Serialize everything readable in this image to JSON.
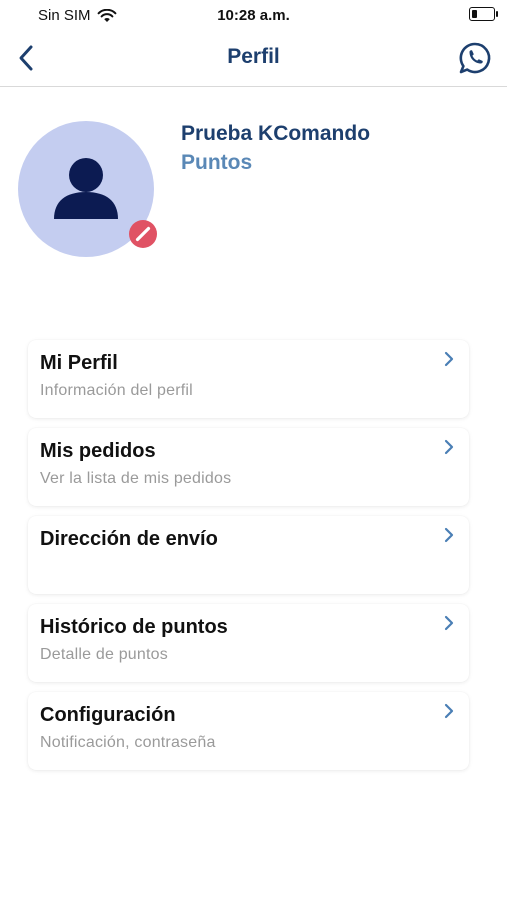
{
  "status_bar": {
    "carrier": "Sin SIM",
    "time": "10:28 a.m."
  },
  "nav": {
    "title": "Perfil",
    "back_icon": "chevron-left-icon",
    "action_icon": "whatsapp-icon"
  },
  "profile": {
    "name": "Prueba KComando",
    "points_label": "Puntos"
  },
  "menu": [
    {
      "title": "Mi Perfil",
      "subtitle": "Información del perfil"
    },
    {
      "title": "Mis pedidos",
      "subtitle": "Ver la lista de mis pedidos"
    },
    {
      "title": "Dirección de envío",
      "subtitle": ""
    },
    {
      "title": "Histórico de puntos",
      "subtitle": "Detalle de puntos"
    },
    {
      "title": "Configuración",
      "subtitle": "Notificación, contraseña"
    }
  ],
  "colors": {
    "primary": "#1d3f6e",
    "secondary": "#5a88b6",
    "avatar_bg": "#c4cdf0",
    "badge": "#e05264",
    "chevron": "#4a7fb5",
    "subtitle": "#9a9a9a"
  }
}
